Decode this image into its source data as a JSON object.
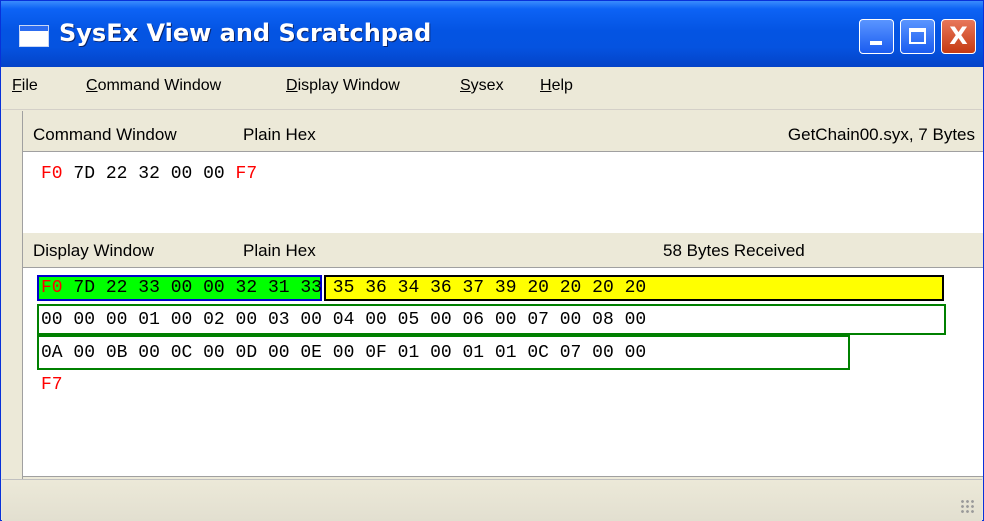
{
  "window": {
    "title": "SysEx View and Scratchpad"
  },
  "title_buttons": {
    "close_symbol": "X"
  },
  "menu": [
    {
      "prefix": "",
      "accel": "F",
      "rest": "ile"
    },
    {
      "prefix": "",
      "accel": "C",
      "rest": "ommand Window"
    },
    {
      "prefix": "",
      "accel": "D",
      "rest": "isplay Window"
    },
    {
      "prefix": "",
      "accel": "S",
      "rest": "ysex"
    },
    {
      "prefix": "",
      "accel": "H",
      "rest": "elp"
    }
  ],
  "command_window": {
    "title": "Command Window",
    "mode": "Plain Hex",
    "file_info": "GetChain00.syx,  7 Bytes",
    "bytes": [
      {
        "v": "F0",
        "color": "red"
      },
      {
        "v": "7D"
      },
      {
        "v": "22"
      },
      {
        "v": "32"
      },
      {
        "v": "00"
      },
      {
        "v": "00"
      },
      {
        "v": "F7",
        "color": "red"
      }
    ]
  },
  "display_window": {
    "title": "Display Window",
    "mode": "Plain Hex",
    "received_info": "58  Bytes Received",
    "rows": [
      [
        "F0",
        "7D",
        "22",
        "33",
        "00",
        "00",
        "32",
        "31",
        "33",
        "35",
        "36",
        "34",
        "36",
        "37",
        "39",
        "20",
        "20",
        "20",
        "20"
      ],
      [
        "00",
        "00",
        "00",
        "01",
        "00",
        "02",
        "00",
        "03",
        "00",
        "04",
        "00",
        "05",
        "00",
        "06",
        "00",
        "07",
        "00",
        "08",
        "00"
      ],
      [
        "0A",
        "00",
        "0B",
        "00",
        "0C",
        "00",
        "0D",
        "00",
        "0E",
        "00",
        "0F",
        "01",
        "00",
        "01",
        "01",
        "0C",
        "07",
        "00",
        "00"
      ],
      [
        "F7"
      ]
    ],
    "highlights": {
      "header_bg": "#00ff00",
      "header_border": "#0000cc",
      "name_bg": "#ffff00",
      "name_border": "#000000",
      "data_border": "#008000",
      "status_color": "#ff0000"
    }
  },
  "colors": {
    "title_bar": "#0454e3",
    "chrome": "#ece9d8",
    "close_button": "#c53a12"
  }
}
